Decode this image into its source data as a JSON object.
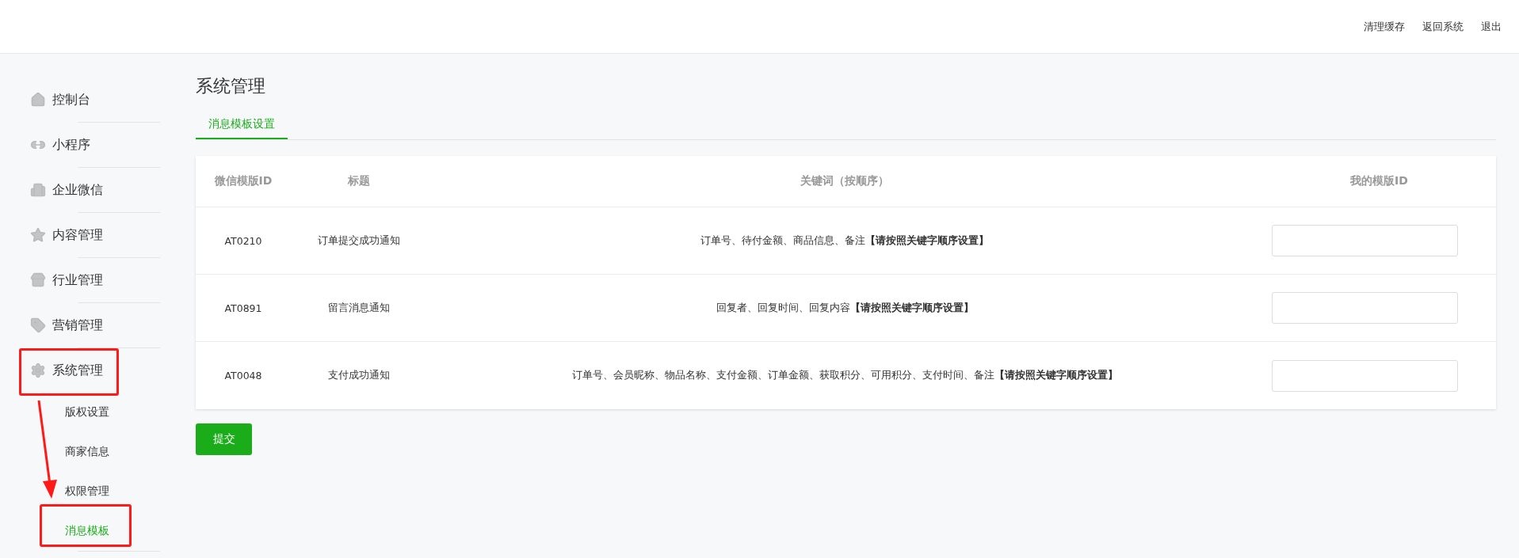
{
  "header": {
    "links": [
      "清理缓存",
      "返回系统",
      "退出"
    ]
  },
  "sidebar": {
    "items": [
      {
        "label": "控制台"
      },
      {
        "label": "小程序"
      },
      {
        "label": "企业微信"
      },
      {
        "label": "内容管理"
      },
      {
        "label": "行业管理"
      },
      {
        "label": "营销管理"
      },
      {
        "label": "系统管理",
        "children": [
          {
            "label": "版权设置",
            "selected": false
          },
          {
            "label": "商家信息",
            "selected": false
          },
          {
            "label": "权限管理",
            "selected": false
          },
          {
            "label": "消息模板",
            "selected": true
          }
        ]
      }
    ]
  },
  "page_title": "系统管理",
  "tabs": [
    {
      "label": "消息模板设置",
      "selected": true
    }
  ],
  "table": {
    "columns": [
      "微信模版ID",
      "标题",
      "关键词（按顺序）",
      "我的模版ID"
    ],
    "rows": [
      {
        "id": "AT0210",
        "title": "订单提交成功通知",
        "keywords": "订单号、待付金额、商品信息、备注**【请按照关键字顺序设置】**"
      },
      {
        "id": "AT0891",
        "title": "留言消息通知",
        "keywords": "回复者、回复时间、回复内容**【请按照关键字顺序设置】**"
      },
      {
        "id": "AT0048",
        "title": "支付成功通知",
        "keywords": "订单号、会员昵称、物品名称、支付金额、订单金额、获取积分、可用积分、支付时间、备注**【请按照关键字顺序设置】**"
      }
    ]
  },
  "submit": "提交"
}
